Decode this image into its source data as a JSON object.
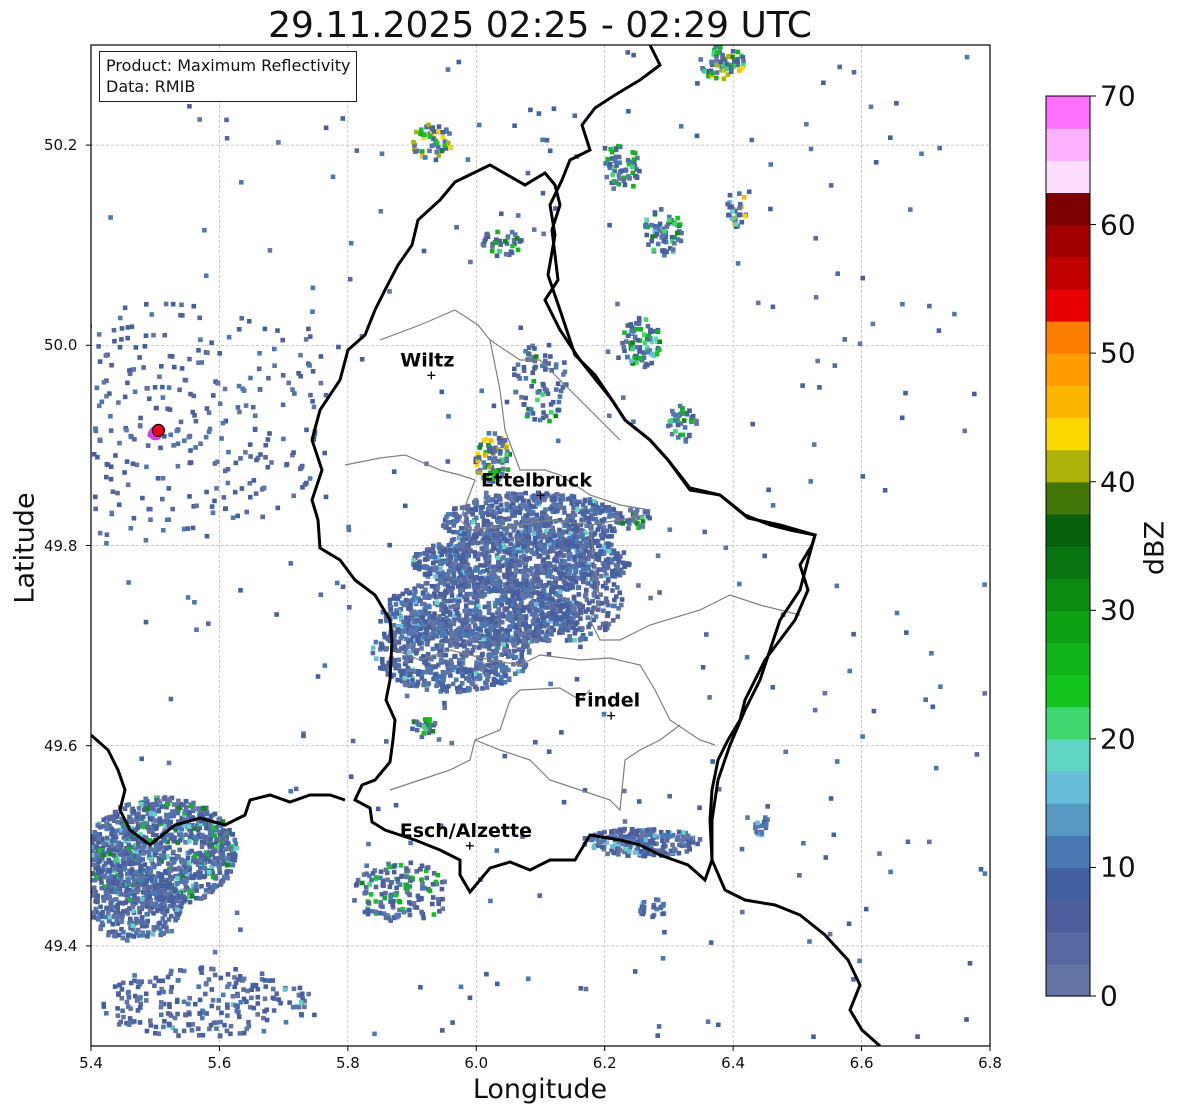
{
  "title": "29.11.2025 02:25 - 02:29 UTC",
  "product_box": {
    "product": "Product: Maximum Reflectivity",
    "data": "Data: RMIB"
  },
  "axes": {
    "xlabel": "Longitude",
    "ylabel": "Latitude",
    "xlim": [
      5.4,
      6.8
    ],
    "ylim": [
      49.3,
      50.3
    ],
    "xticks": [
      "5.4",
      "5.6",
      "5.8",
      "6.0",
      "6.2",
      "6.4",
      "6.6",
      "6.8"
    ],
    "yticks": [
      "49.4",
      "49.6",
      "49.8",
      "50.0",
      "50.2"
    ],
    "grid": true
  },
  "colorbar": {
    "label": "dBZ",
    "range": [
      0,
      70
    ],
    "step": 2.5,
    "ticks": [
      "0",
      "10",
      "20",
      "30",
      "40",
      "50",
      "60",
      "70"
    ],
    "colors": [
      "#6474a4",
      "#5868a0",
      "#4c5e9c",
      "#4360a3",
      "#4a79b4",
      "#5899c4",
      "#67bedb",
      "#5fd6c4",
      "#3ed770",
      "#12c41d",
      "#10b418",
      "#0fa114",
      "#0d8a10",
      "#0a7411",
      "#07600b",
      "#437609",
      "#adb308",
      "#fdd700",
      "#fdb600",
      "#fe9c01",
      "#fe7e00",
      "#e70000",
      "#c10000",
      "#a20000",
      "#7c0000",
      "#fddcff",
      "#feb1ff",
      "#fe70ff",
      "#ea34eb"
    ]
  },
  "cities": [
    {
      "name": "Wiltz",
      "lon": 5.93,
      "lat": 49.97
    },
    {
      "name": "Ettelbruck",
      "lon": 6.1,
      "lat": 49.85
    },
    {
      "name": "Findel",
      "lon": 6.21,
      "lat": 49.63
    },
    {
      "name": "Esch/Alzette",
      "lon": 5.99,
      "lat": 49.5
    }
  ],
  "radar_site": {
    "lon": 5.505,
    "lat": 49.915
  },
  "map_colors": {
    "border": "#000000",
    "cantons": "#808080",
    "grid": "#b5b5b5",
    "background": "#ffffff"
  }
}
